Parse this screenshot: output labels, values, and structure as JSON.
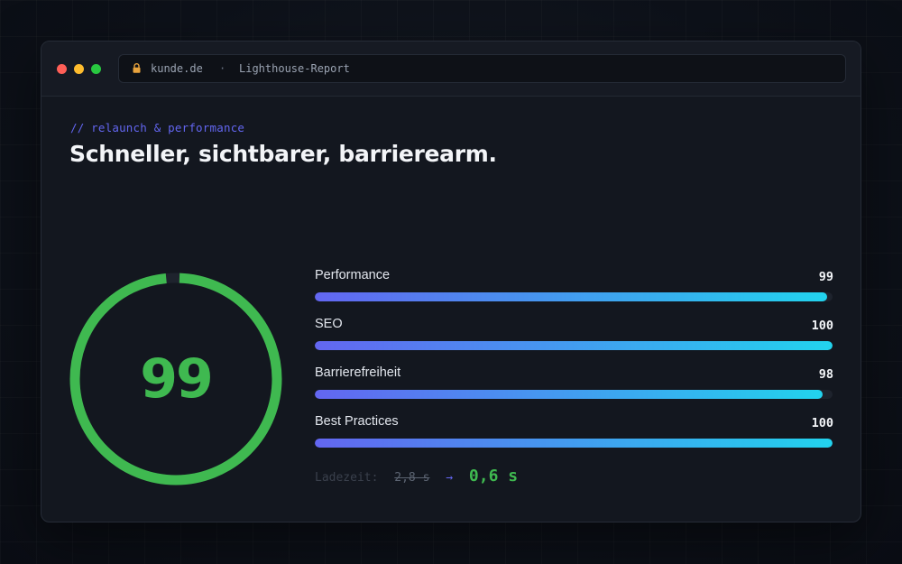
{
  "browser": {
    "domain": "kunde.de",
    "separator": "·",
    "page": "Lighthouse-Report",
    "lock_icon": "lock-icon"
  },
  "header": {
    "eyebrow": "// relaunch & performance",
    "title": "Schneller, sichtbarer, barrierearm."
  },
  "gauge": {
    "value": "99",
    "score": 99,
    "color": "#3fb950"
  },
  "metrics": [
    {
      "label": "Performance",
      "score": "99",
      "value": 99
    },
    {
      "label": "SEO",
      "score": "100",
      "value": 100
    },
    {
      "label": "Barrierefreiheit",
      "score": "98",
      "value": 98
    },
    {
      "label": "Best Practices",
      "score": "100",
      "value": 100
    }
  ],
  "loadtime": {
    "label": "Ladezeit:",
    "old": "2,8 s",
    "arrow": "→",
    "new": "0,6 s"
  },
  "colors": {
    "traffic_red": "#ff5f57",
    "traffic_yellow": "#febc2e",
    "traffic_green": "#28c840",
    "accent": "#6366f1",
    "bar_gradient_start": "#6366f1",
    "bar_gradient_end": "#22d3ee",
    "success": "#3fb950"
  }
}
